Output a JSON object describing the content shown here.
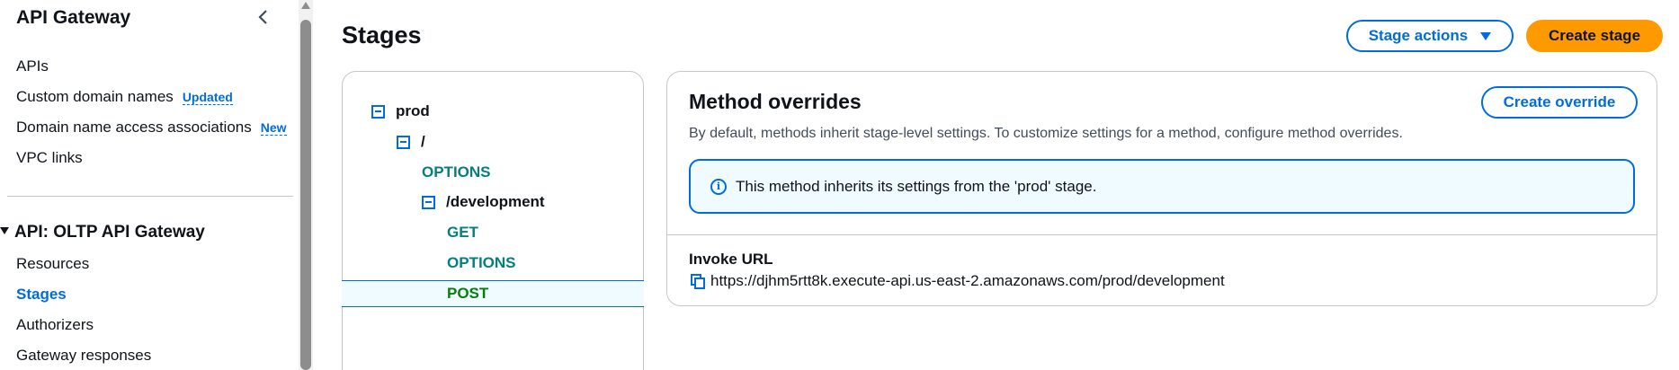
{
  "sidebar": {
    "title": "API Gateway",
    "top_items": [
      {
        "label": "APIs"
      },
      {
        "label": "Custom domain names",
        "badge": "Updated"
      },
      {
        "label": "Domain name access associations",
        "badge": "New"
      },
      {
        "label": "VPC links"
      }
    ],
    "api_section_title": "API: OLTP API Gateway",
    "api_items": [
      {
        "label": "Resources"
      },
      {
        "label": "Stages",
        "active": true
      },
      {
        "label": "Authorizers"
      },
      {
        "label": "Gateway responses"
      }
    ]
  },
  "header": {
    "title": "Stages",
    "stage_actions_label": "Stage actions",
    "create_stage_label": "Create stage"
  },
  "tree": {
    "stage": "prod",
    "root": "/",
    "root_method": "OPTIONS",
    "resource": "/development",
    "methods": [
      "GET",
      "OPTIONS",
      "POST"
    ],
    "selected_method": "POST"
  },
  "method_overrides": {
    "title": "Method overrides",
    "create_override_label": "Create override",
    "description": "By default, methods inherit stage-level settings. To customize settings for a method, configure method overrides.",
    "info_icon_glyph": "i",
    "info_text": "This method inherits its settings from the 'prod' stage.",
    "invoke_url_label": "Invoke URL",
    "invoke_url": "https://djhm5rtt8k.execute-api.us-east-2.amazonaws.com/prod/development"
  },
  "colors": {
    "accent": "#006ce0",
    "primary_button": "#ff9900",
    "method_text": "#037f7f",
    "selected_method_text": "#037f0c",
    "info_background": "#f0fbff"
  },
  "icons": [
    "chevron-left-icon",
    "caret-down-icon",
    "tree-collapse-icon",
    "info-icon",
    "copy-icon"
  ]
}
